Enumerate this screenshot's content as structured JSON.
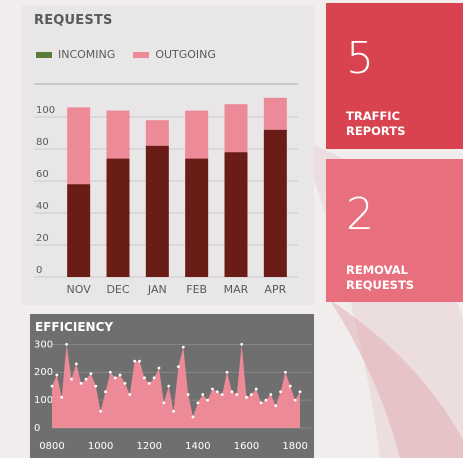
{
  "requests": {
    "title": "REQUESTS",
    "legend": [
      {
        "label": "INCOMING",
        "color": "#5a7a3c"
      },
      {
        "label": "OUTGOING",
        "color": "#ec8a97"
      }
    ]
  },
  "tiles": {
    "traffic": {
      "number": "5",
      "line1": "TRAFFIC",
      "line2": "REPORTS"
    },
    "removal": {
      "number": "2",
      "line1": "REMOVAL",
      "line2": "REQUESTS"
    }
  },
  "efficiency": {
    "title": "EFFICIENCY"
  },
  "colors": {
    "incoming_bar": "#6a1d17",
    "outgoing_bar": "#ec8a97",
    "tile_red": "#d9434f",
    "tile_pink": "#e8707e",
    "area_fill": "#ec8a97"
  },
  "chart_data": [
    {
      "type": "bar",
      "title": "REQUESTS",
      "categories": [
        "NOV",
        "DEC",
        "JAN",
        "FEB",
        "MAR",
        "APR"
      ],
      "series": [
        {
          "name": "INCOMING",
          "values": [
            58,
            74,
            82,
            74,
            78,
            92
          ]
        },
        {
          "name": "OUTGOING",
          "values": [
            48,
            30,
            16,
            30,
            30,
            20
          ]
        }
      ],
      "stacked": true,
      "ylim": [
        0,
        120
      ],
      "yticks": [
        0,
        20,
        40,
        60,
        80,
        100
      ],
      "grid": true,
      "legend_position": "top-left"
    },
    {
      "type": "area",
      "title": "EFFICIENCY",
      "x": [
        800,
        820,
        840,
        860,
        880,
        900,
        920,
        940,
        960,
        980,
        1000,
        1020,
        1040,
        1060,
        1080,
        1100,
        1120,
        1140,
        1160,
        1180,
        1200,
        1220,
        1240,
        1260,
        1280,
        1300,
        1320,
        1340,
        1360,
        1380,
        1400,
        1420,
        1440,
        1460,
        1480,
        1500,
        1520,
        1540,
        1560,
        1580,
        1600,
        1620,
        1640,
        1660,
        1680,
        1700,
        1720,
        1740,
        1760,
        1780,
        1800,
        1820
      ],
      "y": [
        150,
        190,
        110,
        300,
        175,
        230,
        160,
        175,
        195,
        150,
        60,
        130,
        200,
        180,
        190,
        160,
        120,
        240,
        240,
        180,
        160,
        180,
        215,
        90,
        150,
        60,
        220,
        290,
        120,
        40,
        90,
        120,
        100,
        140,
        130,
        120,
        200,
        130,
        120,
        300,
        110,
        120,
        140,
        90,
        100,
        120,
        80,
        130,
        200,
        150,
        100,
        130
      ],
      "xticks": [
        "0800",
        "1000",
        "1200",
        "1400",
        "1600",
        "1800"
      ],
      "yticks": [
        0,
        100,
        200,
        300
      ],
      "ylim": [
        0,
        330
      ],
      "grid": true
    }
  ]
}
